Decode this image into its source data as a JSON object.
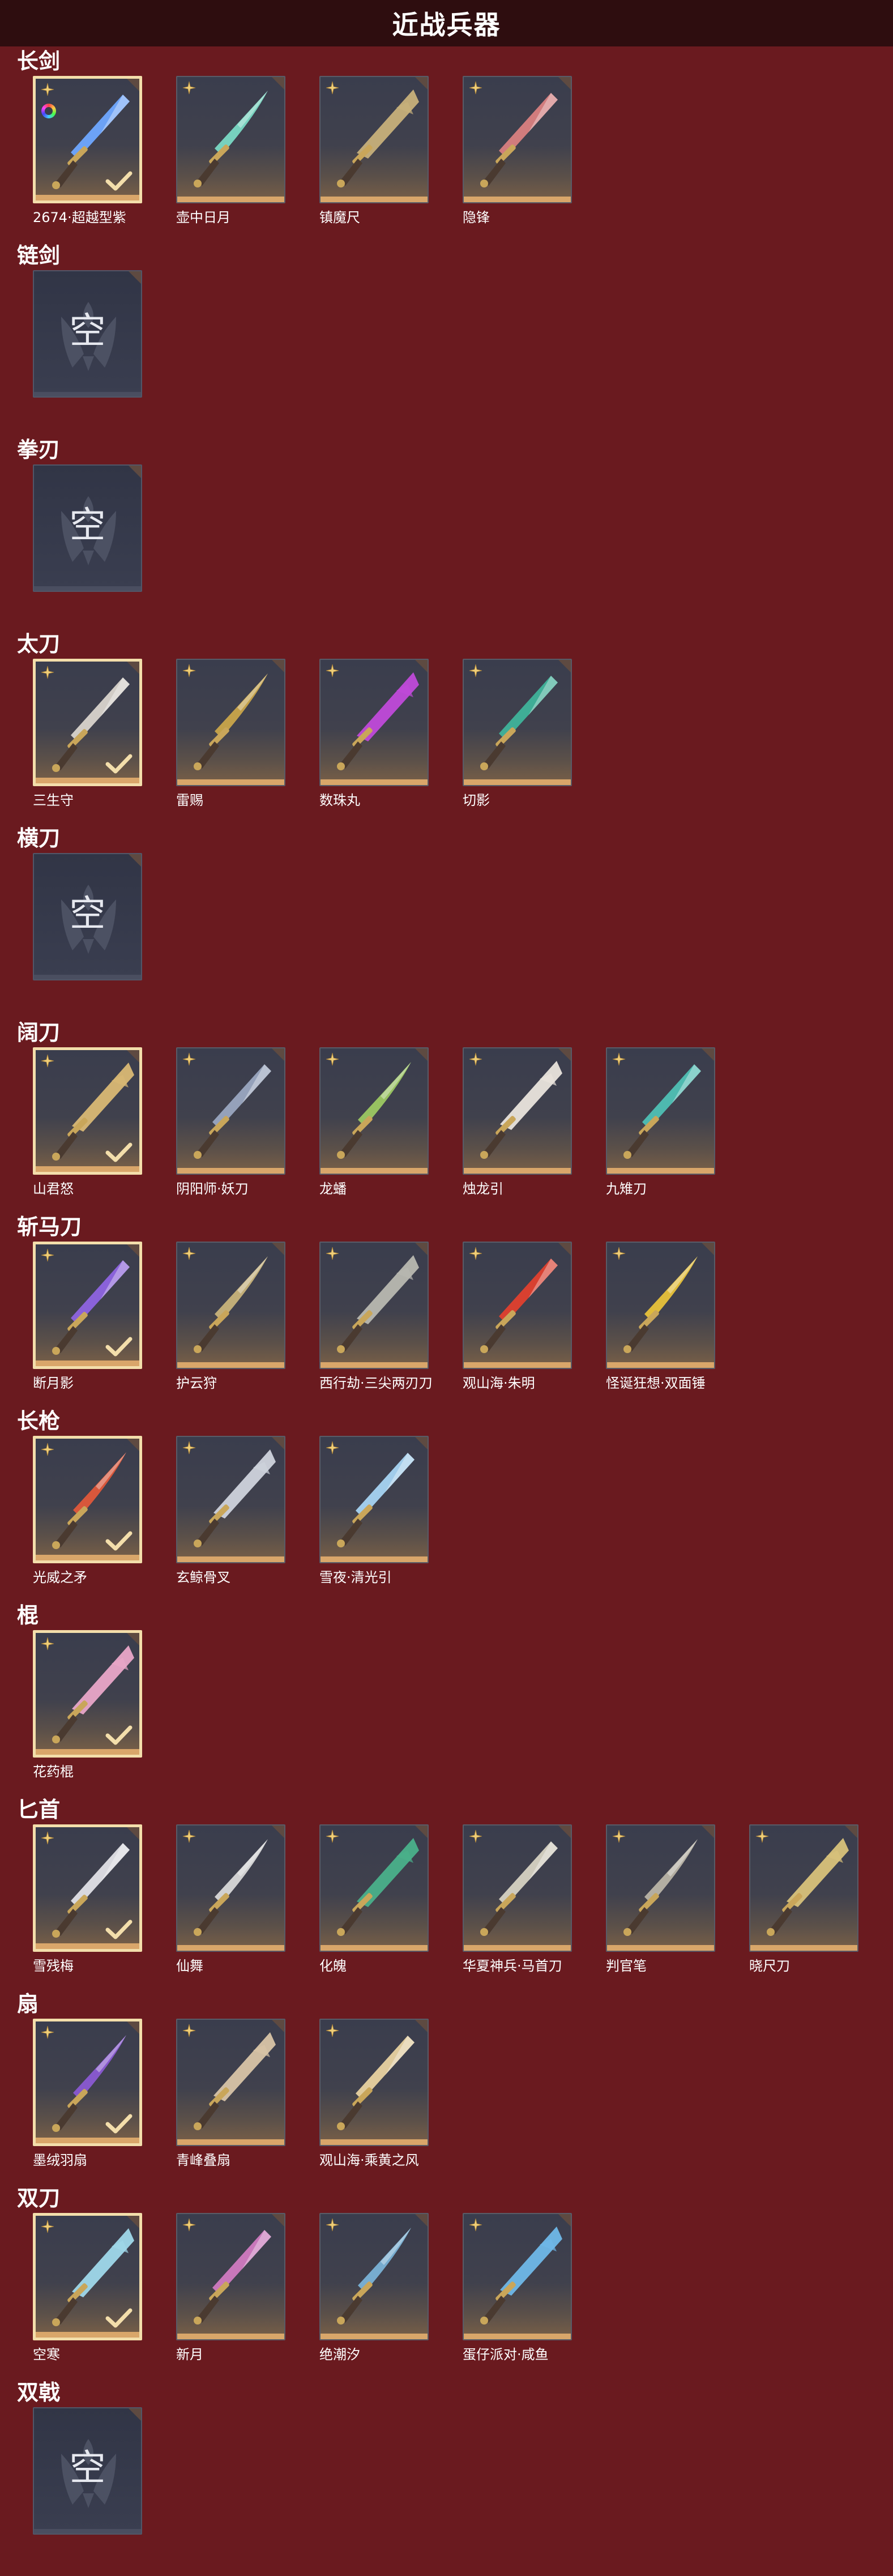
{
  "page": {
    "title": "近战兵器"
  },
  "empty_label": "空",
  "colors": {
    "background": "#6a1a1f",
    "title_bar": "#2e0d0f",
    "selected_border": "#f3deab",
    "bottom_bar": "#d9a66a"
  },
  "sections": [
    {
      "title": "长剑",
      "items": [
        {
          "name": "2674·超越型紫",
          "selected": true,
          "icon": "long-sword-blue-icon",
          "accent": "#6fa8ff"
        },
        {
          "name": "壶中日月",
          "selected": false,
          "icon": "long-sword-jade-icon",
          "accent": "#7ad9c4"
        },
        {
          "name": "镇魔尺",
          "selected": false,
          "icon": "long-sword-gold-icon",
          "accent": "#c7b07a"
        },
        {
          "name": "隐锋",
          "selected": false,
          "icon": "long-sword-red-icon",
          "accent": "#d98080"
        }
      ]
    },
    {
      "title": "链剑",
      "items": []
    },
    {
      "title": "拳刃",
      "items": []
    },
    {
      "title": "太刀",
      "items": [
        {
          "name": "三生守",
          "selected": true,
          "icon": "katana-silver-icon",
          "accent": "#d9d4cc"
        },
        {
          "name": "雷赐",
          "selected": false,
          "icon": "katana-gold-icon",
          "accent": "#c9a54a"
        },
        {
          "name": "数珠丸",
          "selected": false,
          "icon": "katana-purple-icon",
          "accent": "#c04ad9"
        },
        {
          "name": "切影",
          "selected": false,
          "icon": "katana-teal-icon",
          "accent": "#3fb39a"
        }
      ]
    },
    {
      "title": "横刀",
      "items": []
    },
    {
      "title": "阔刀",
      "items": [
        {
          "name": "山君怒",
          "selected": true,
          "icon": "broadblade-gold-icon",
          "accent": "#d9b874"
        },
        {
          "name": "阴阳师·妖刀",
          "selected": false,
          "icon": "broadblade-dark-icon",
          "accent": "#9aa7c0"
        },
        {
          "name": "龙蟠",
          "selected": false,
          "icon": "broadblade-green-icon",
          "accent": "#9cc862"
        },
        {
          "name": "烛龙引",
          "selected": false,
          "icon": "broadblade-white-icon",
          "accent": "#e9e4dc"
        },
        {
          "name": "九雉刀",
          "selected": false,
          "icon": "broadblade-cyan-icon",
          "accent": "#4fc0b4"
        }
      ]
    },
    {
      "title": "斩马刀",
      "items": [
        {
          "name": "断月影",
          "selected": true,
          "icon": "zhanmadao-purple-icon",
          "accent": "#8e64e0"
        },
        {
          "name": "护云狩",
          "selected": false,
          "icon": "zhanmadao-gold-icon",
          "accent": "#c8b37a"
        },
        {
          "name": "西行劫·三尖两刃刀",
          "selected": false,
          "icon": "zhanmadao-steel-icon",
          "accent": "#b8b8b0"
        },
        {
          "name": "观山海·朱明",
          "selected": false,
          "icon": "zhanmadao-red-icon",
          "accent": "#e0402e"
        },
        {
          "name": "怪诞狂想·双面锤",
          "selected": false,
          "icon": "hammer-toy-icon",
          "accent": "#e8c23a"
        }
      ]
    },
    {
      "title": "长枪",
      "items": [
        {
          "name": "光威之矛",
          "selected": true,
          "icon": "spear-red-icon",
          "accent": "#e0583a"
        },
        {
          "name": "玄鲸骨叉",
          "selected": false,
          "icon": "trident-silver-icon",
          "accent": "#cfd3dc"
        },
        {
          "name": "雪夜·清光引",
          "selected": false,
          "icon": "spear-ice-icon",
          "accent": "#a6d4f2"
        }
      ]
    },
    {
      "title": "棍",
      "items": [
        {
          "name": "花药棍",
          "selected": true,
          "icon": "staff-flower-icon",
          "accent": "#e9a6c8"
        }
      ]
    },
    {
      "title": "匕首",
      "items": [
        {
          "name": "雪残梅",
          "selected": true,
          "icon": "dagger-plum-icon",
          "accent": "#e0e0e6"
        },
        {
          "name": "仙舞",
          "selected": false,
          "icon": "dagger-dance-icon",
          "accent": "#d8d8d8"
        },
        {
          "name": "化魄",
          "selected": false,
          "icon": "dagger-green-icon",
          "accent": "#4ab08a"
        },
        {
          "name": "华夏神兵·马首刀",
          "selected": false,
          "icon": "dagger-horse-icon",
          "accent": "#d6d2c2"
        },
        {
          "name": "判官笔",
          "selected": false,
          "icon": "judge-brush-icon",
          "accent": "#b9b4a6"
        },
        {
          "name": "晓尺刀",
          "selected": false,
          "icon": "dagger-gold-icon",
          "accent": "#d8c27a"
        }
      ]
    },
    {
      "title": "扇",
      "items": [
        {
          "name": "墨绒羽扇",
          "selected": true,
          "icon": "fan-feather-icon",
          "accent": "#8a5ad2"
        },
        {
          "name": "青峰叠扇",
          "selected": false,
          "icon": "fan-folding-icon",
          "accent": "#d8c4a6"
        },
        {
          "name": "观山海·乘黄之风",
          "selected": false,
          "icon": "fan-gold-icon",
          "accent": "#e8d2a0"
        }
      ]
    },
    {
      "title": "双刀",
      "items": [
        {
          "name": "空寒",
          "selected": true,
          "icon": "dual-blade-ice-icon",
          "accent": "#9fd8ea"
        },
        {
          "name": "新月",
          "selected": false,
          "icon": "dual-blade-moon-icon",
          "accent": "#d07ac0"
        },
        {
          "name": "绝潮汐",
          "selected": false,
          "icon": "dual-blade-tide-icon",
          "accent": "#7ab2d6"
        },
        {
          "name": "蛋仔派对·咸鱼",
          "selected": false,
          "icon": "salted-fish-icon",
          "accent": "#6fb8e8"
        }
      ]
    },
    {
      "title": "双戟",
      "items": []
    }
  ]
}
